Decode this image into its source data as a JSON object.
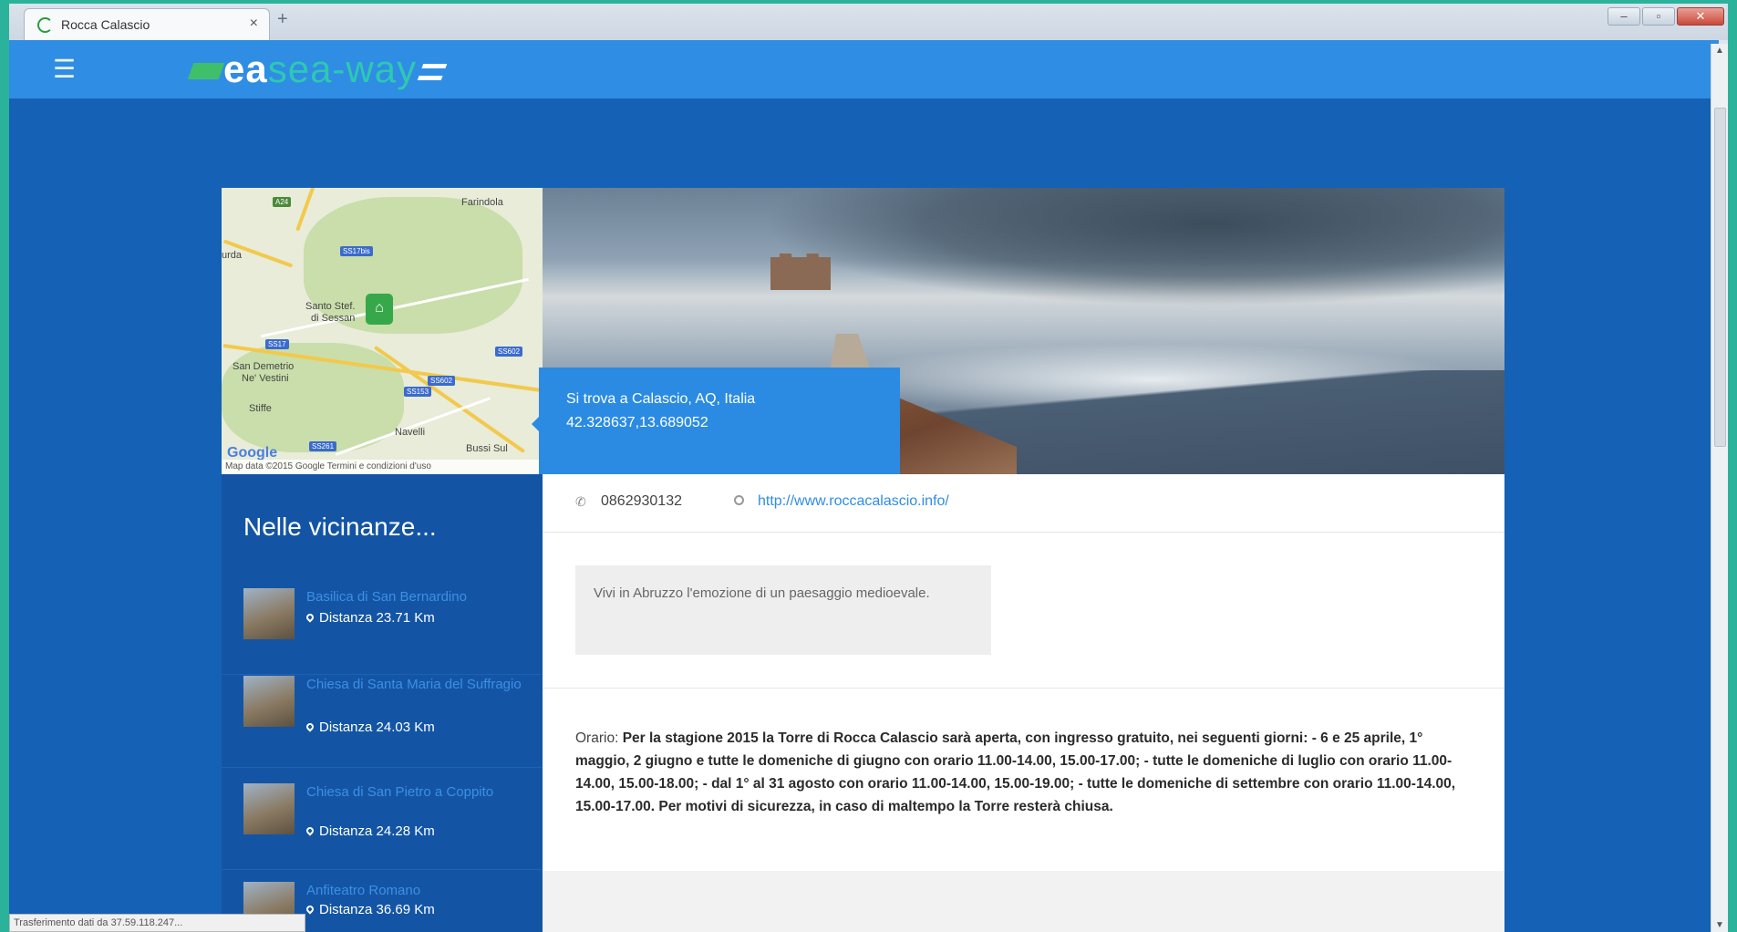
{
  "browser": {
    "tab_title": "Rocca Calascio",
    "tab_close": "×",
    "new_tab": "+",
    "status": "Trasferimento dati da 37.59.118.247..."
  },
  "header": {
    "menu_icon": "☰",
    "logo_part1": "ea",
    "logo_part2": "sea-way"
  },
  "map": {
    "labels": [
      "Farindola",
      "Santo Stef.",
      "di Sessan",
      "San Demetrio",
      "Ne' Vestini",
      "Stiffe",
      "Navelli",
      "Bussi Sul",
      "urda"
    ],
    "shields": [
      "A24",
      "SS17bis",
      "SS17",
      "SS602",
      "SS153",
      "SS261",
      "SS602"
    ],
    "google": "Google",
    "footer": "Map data ©2015 Google  Termini e condizioni d'uso"
  },
  "location": {
    "line1": "Si trova a Calascio, AQ, Italia",
    "coords": "42.328637,13.689052"
  },
  "contact": {
    "phone": "0862930132",
    "website": "http://www.roccacalascio.info/"
  },
  "description": "Vivi in Abruzzo l'emozione di un paesaggio medioevale.",
  "hours": {
    "label": "Orario: ",
    "text": "Per la stagione 2015 la Torre di Rocca Calascio sarà aperta, con ingresso gratuito, nei seguenti giorni: - 6 e 25 aprile, 1° maggio, 2 giugno e tutte le domeniche di giugno con orario 11.00-14.00, 15.00-17.00; - tutte le domeniche di luglio con orario 11.00-14.00, 15.00-18.00; - dal 1° al 31 agosto con orario 11.00-14.00, 15.00-19.00; - tutte le domeniche di settembre con orario 11.00-14.00, 15.00-17.00. Per motivi di sicurezza, in caso di maltempo la Torre resterà chiusa."
  },
  "nearby": {
    "title": "Nelle vicinanze...",
    "items": [
      {
        "name": "Basilica di San Bernardino",
        "distance": "Distanza 23.71 Km"
      },
      {
        "name": "Chiesa di Santa Maria del Suffragio",
        "distance": "Distanza 24.03 Km"
      },
      {
        "name": "Chiesa di San Pietro a Coppito",
        "distance": "Distanza 24.28 Km"
      },
      {
        "name": "Anfiteatro Romano",
        "distance": "Distanza 36.69 Km"
      }
    ]
  },
  "colors": {
    "header": "#2f8de4",
    "page_bg": "#1561b5",
    "sidebar_bg": "#1355a4",
    "link": "#2f8de4"
  }
}
